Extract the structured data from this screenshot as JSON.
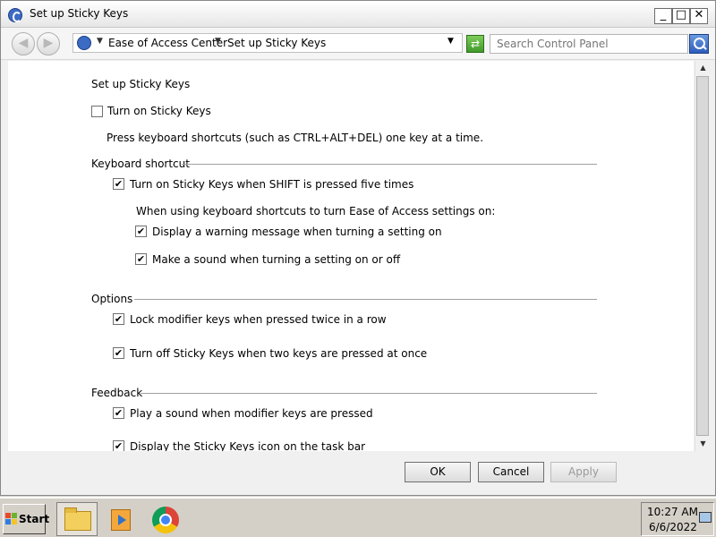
{
  "window": {
    "title": "Set up Sticky Keys",
    "controls": {
      "minimize": "_",
      "maximize": "□",
      "close": "✕"
    }
  },
  "address_bar": {
    "back_glyph": "◀",
    "forward_glyph": "▶",
    "crumb_arrow": "▼",
    "breadcrumbs": [
      "Ease of Access Center",
      "Set up Sticky Keys"
    ],
    "refresh_glyph": "⇄",
    "search_placeholder": "Search Control Panel"
  },
  "content": {
    "heading": "Set up Sticky Keys",
    "turn_on": {
      "label": "Turn on Sticky Keys",
      "checked": false
    },
    "description": "Press keyboard shortcuts (such as CTRL+ALT+DEL) one key at a time.",
    "sections": {
      "keyboard_shortcut": {
        "title": "Keyboard shortcut",
        "shift_five": {
          "label": "Turn on Sticky Keys when SHIFT is pressed five times",
          "checked": true
        },
        "sub_heading": "When using keyboard shortcuts to turn Ease of Access settings on:",
        "warning": {
          "label": "Display a warning message when turning a setting on",
          "checked": true
        },
        "sound": {
          "label": "Make a sound when turning a setting on or off",
          "checked": true
        }
      },
      "options": {
        "title": "Options",
        "lock_modifier": {
          "label": "Lock modifier keys when pressed twice in a row",
          "checked": true
        },
        "turn_off_two": {
          "label": "Turn off Sticky Keys when two keys are pressed at once",
          "checked": true
        }
      },
      "feedback": {
        "title": "Feedback",
        "play_sound": {
          "label": "Play a sound when modifier keys are pressed",
          "checked": true
        },
        "display_icon": {
          "label": "Display the Sticky Keys icon on the task bar",
          "checked": true
        }
      }
    },
    "checkmark": "✔"
  },
  "scrollbar": {
    "up": "▲",
    "down": "▼"
  },
  "buttons": {
    "ok": "OK",
    "cancel": "Cancel",
    "apply": "Apply"
  },
  "taskbar": {
    "start": "Start",
    "clock_time": "10:27 AM",
    "clock_date": "6/6/2022"
  }
}
